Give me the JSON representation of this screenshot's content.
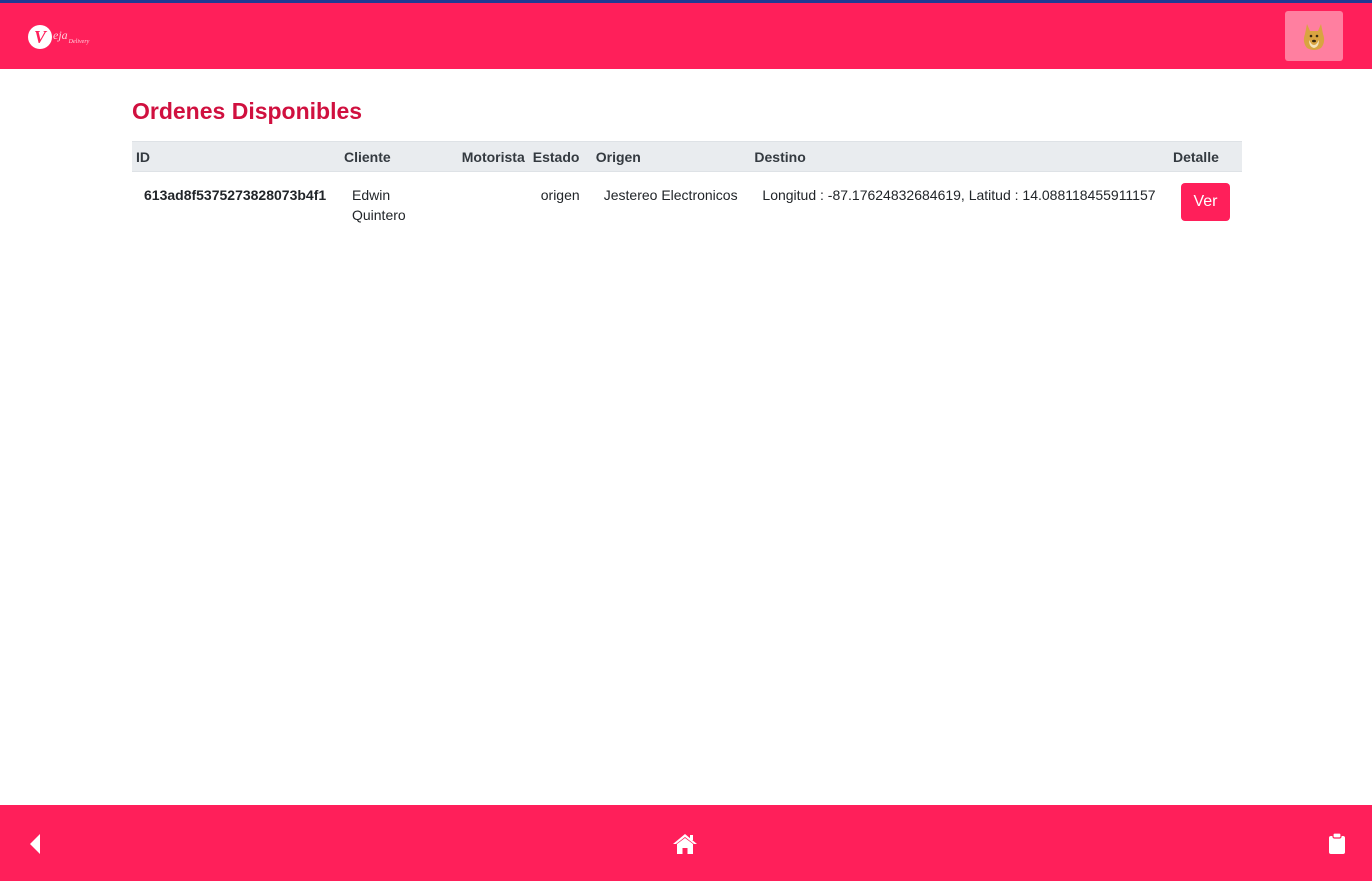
{
  "header": {
    "logo_letter": "V",
    "logo_text": "eja",
    "logo_sub": "Delivery",
    "avatar_icon": "doge-avatar-icon"
  },
  "main": {
    "title": "Ordenes Disponibles",
    "table": {
      "columns": [
        "ID",
        "Cliente",
        "Motorista",
        "Estado",
        "Origen",
        "Destino",
        "Detalle"
      ],
      "rows": [
        {
          "id": "613ad8f5375273828073b4f1",
          "cliente": "Edwin Quintero",
          "motorista": "",
          "estado": "origen",
          "origen": "Jestereo Electronicos",
          "destino": "Longitud : -87.17624832684619, Latitud : 14.088118455911157",
          "detalle_label": "Ver"
        }
      ]
    }
  },
  "footer": {
    "icons": [
      "back-icon",
      "home-icon",
      "clipboard-icon"
    ]
  },
  "colors": {
    "brand": "#ff1f5a",
    "title": "#d0103f",
    "header_strip": "#1f3a93"
  }
}
